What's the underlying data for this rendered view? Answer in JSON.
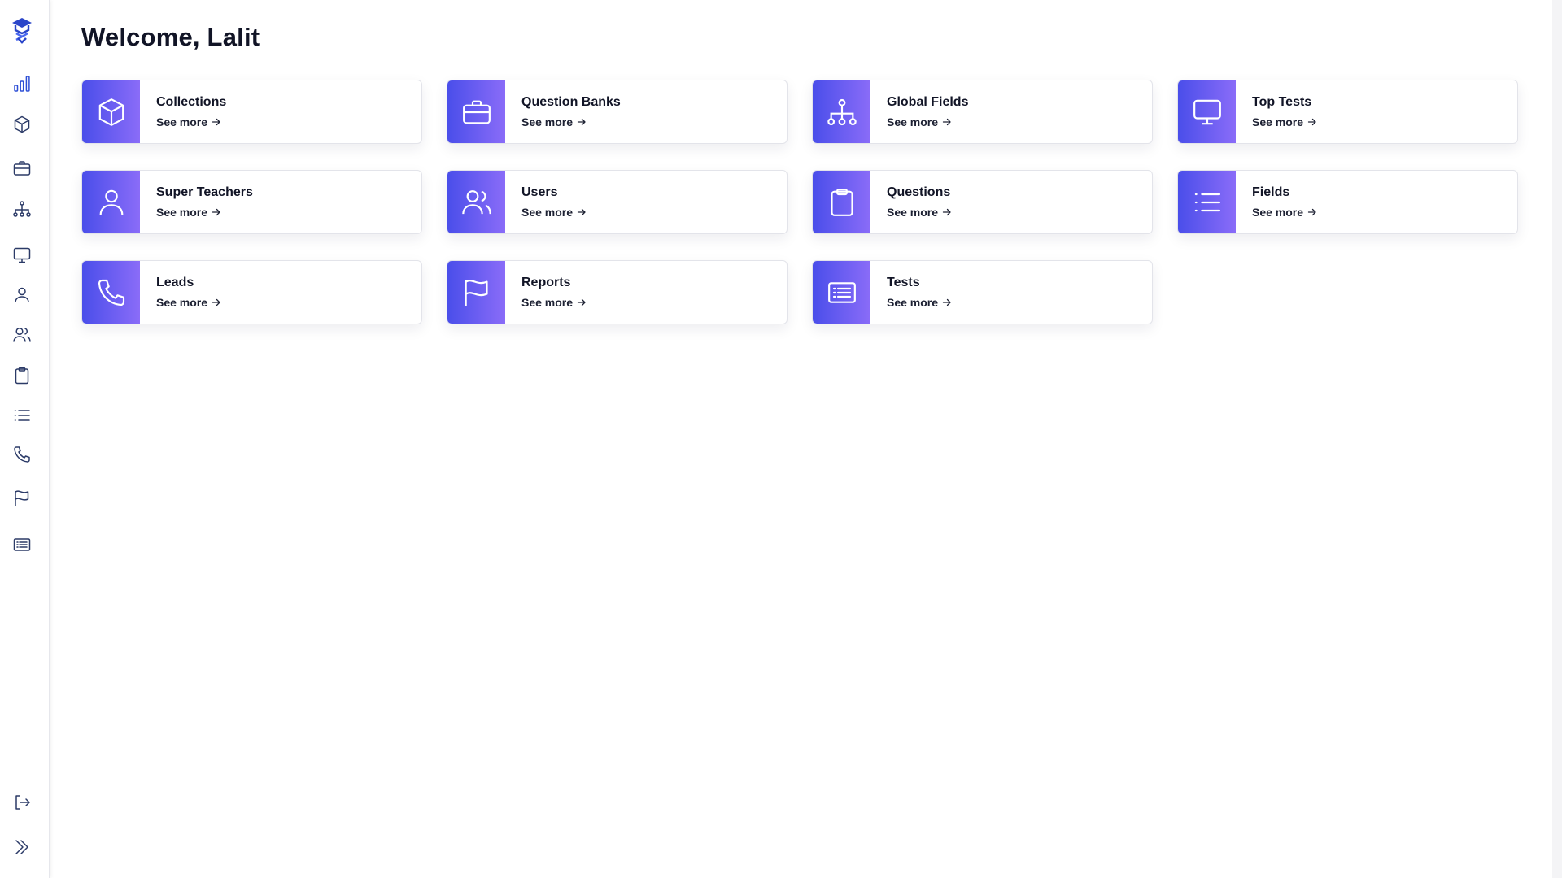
{
  "app": {
    "logo_icon": "graduation-cap-logo",
    "accent_color": "#4a4eea",
    "accent_gradient_end": "#8a6cf8"
  },
  "sidebar": {
    "items": [
      {
        "name": "dashboard",
        "icon": "bar-chart-icon"
      },
      {
        "name": "collections",
        "icon": "box-icon"
      },
      {
        "name": "question-banks",
        "icon": "briefcase-icon"
      },
      {
        "name": "global-fields",
        "icon": "hierarchy-icon"
      },
      {
        "name": "top-tests",
        "icon": "monitor-icon"
      },
      {
        "name": "super-teachers",
        "icon": "user-icon"
      },
      {
        "name": "users",
        "icon": "users-icon"
      },
      {
        "name": "questions",
        "icon": "clipboard-icon"
      },
      {
        "name": "fields",
        "icon": "list-icon"
      },
      {
        "name": "leads",
        "icon": "phone-icon"
      },
      {
        "name": "reports",
        "icon": "flag-icon"
      },
      {
        "name": "tests",
        "icon": "document-list-icon"
      }
    ],
    "bottom": [
      {
        "name": "logout",
        "icon": "logout-icon"
      },
      {
        "name": "expand",
        "icon": "double-chevron-right-icon"
      }
    ]
  },
  "main": {
    "title": "Welcome, Lalit",
    "cards": [
      {
        "title": "Collections",
        "link": "See more",
        "icon": "box-icon"
      },
      {
        "title": "Question Banks",
        "link": "See more",
        "icon": "briefcase-icon"
      },
      {
        "title": "Global Fields",
        "link": "See more",
        "icon": "hierarchy-icon"
      },
      {
        "title": "Top Tests",
        "link": "See more",
        "icon": "monitor-icon"
      },
      {
        "title": "Super Teachers",
        "link": "See more",
        "icon": "user-icon"
      },
      {
        "title": "Users",
        "link": "See more",
        "icon": "users-icon"
      },
      {
        "title": "Questions",
        "link": "See more",
        "icon": "clipboard-icon"
      },
      {
        "title": "Fields",
        "link": "See more",
        "icon": "list-icon"
      },
      {
        "title": "Leads",
        "link": "See more",
        "icon": "phone-icon"
      },
      {
        "title": "Reports",
        "link": "See more",
        "icon": "flag-icon"
      },
      {
        "title": "Tests",
        "link": "See more",
        "icon": "document-list-icon"
      }
    ]
  }
}
